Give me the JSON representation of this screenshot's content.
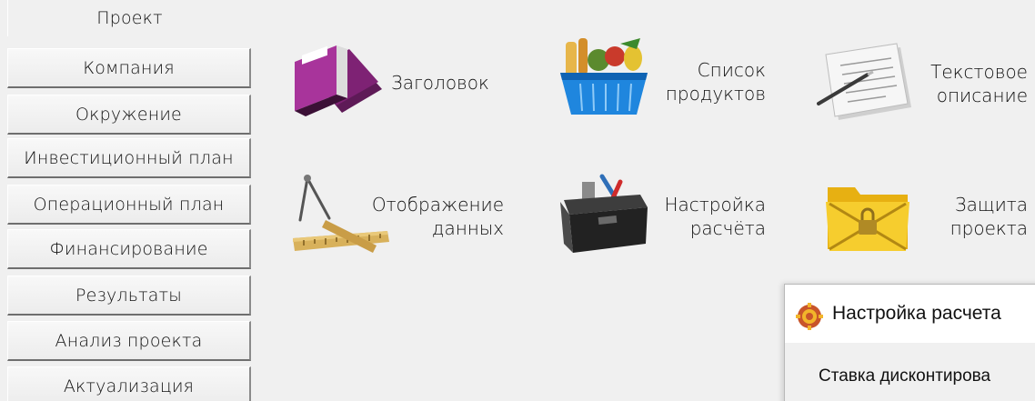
{
  "nav": {
    "items": [
      {
        "label": "Проект",
        "active": true
      },
      {
        "label": "Компания"
      },
      {
        "label": "Окружение"
      },
      {
        "label": "Инвестиционный план"
      },
      {
        "label": "Операционный план"
      },
      {
        "label": "Финансирование"
      },
      {
        "label": "Результаты"
      },
      {
        "label": "Анализ проекта"
      },
      {
        "label": "Актуализация"
      }
    ]
  },
  "tiles": {
    "header": {
      "line1": "Заголовок",
      "icon": "books-icon"
    },
    "products": {
      "line1": "Список",
      "line2": "продуктов",
      "icon": "shopping-basket-icon"
    },
    "text": {
      "line1": "Текстовое",
      "line2": "описание",
      "icon": "document-pen-icon"
    },
    "display": {
      "line1": "Отображение",
      "line2": "данных",
      "icon": "compass-ruler-icon"
    },
    "calc": {
      "line1": "Настройка",
      "line2": "расчёта",
      "icon": "toolbox-icon"
    },
    "protect": {
      "line1": "Защита",
      "line2": "проекта",
      "icon": "locked-folder-icon"
    }
  },
  "dialog": {
    "title": "Настройка расчета",
    "field_label": "Ставка дисконтирова",
    "icon": "app-gear-icon"
  },
  "colors": {
    "background": "#f0f0f0",
    "book": "#9b2a8f",
    "basket": "#1e8ae0",
    "folder": "#f2c21c"
  }
}
